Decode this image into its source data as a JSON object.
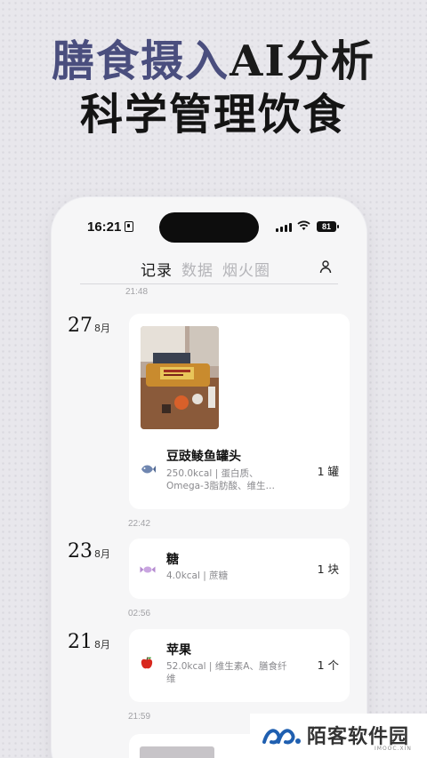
{
  "headline": {
    "line1_accent": "膳食摄入",
    "line1_rest": "AI分析",
    "line2": "科学管理饮食"
  },
  "status_bar": {
    "time": "16:21",
    "battery": "81"
  },
  "tabs": [
    {
      "label": "记录",
      "active": true
    },
    {
      "label": "数据",
      "active": false
    },
    {
      "label": "烟火圈",
      "active": false
    }
  ],
  "timeline": {
    "top_time": "21:48",
    "entries": [
      {
        "day": "27",
        "month": "8月",
        "has_photo": true,
        "name": "豆豉鲮鱼罐头",
        "icon": "fish-icon",
        "info": "250.0kcal | 蛋白质、Omega-3脂肪酸、维生…",
        "qty": "1  罐",
        "time_after": "22:42"
      },
      {
        "day": "23",
        "month": "8月",
        "has_photo": false,
        "name": "糖",
        "icon": "candy-icon",
        "info": "4.0kcal | 蔗糖",
        "qty": "1  块",
        "time_after": "02:56"
      },
      {
        "day": "21",
        "month": "8月",
        "has_photo": false,
        "name": "苹果",
        "icon": "apple-icon",
        "info": "52.0kcal | 维生素A、膳食纤维",
        "qty": "1  个",
        "time_after": "21:59"
      }
    ]
  },
  "watermark": {
    "text": "陌客软件园",
    "sub": "IMOOC.XIN"
  },
  "colors": {
    "accent": "#4a4e7e",
    "background": "#e8e7ec",
    "card": "#ffffff"
  }
}
